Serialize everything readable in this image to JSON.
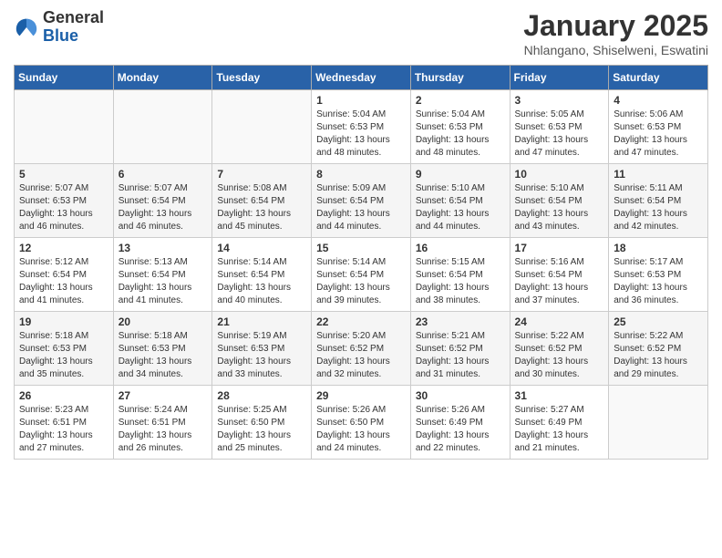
{
  "header": {
    "logo_general": "General",
    "logo_blue": "Blue",
    "title": "January 2025",
    "subtitle": "Nhlangano, Shiselweni, Eswatini"
  },
  "weekdays": [
    "Sunday",
    "Monday",
    "Tuesday",
    "Wednesday",
    "Thursday",
    "Friday",
    "Saturday"
  ],
  "weeks": [
    [
      {
        "num": "",
        "info": ""
      },
      {
        "num": "",
        "info": ""
      },
      {
        "num": "",
        "info": ""
      },
      {
        "num": "1",
        "info": "Sunrise: 5:04 AM\nSunset: 6:53 PM\nDaylight: 13 hours\nand 48 minutes."
      },
      {
        "num": "2",
        "info": "Sunrise: 5:04 AM\nSunset: 6:53 PM\nDaylight: 13 hours\nand 48 minutes."
      },
      {
        "num": "3",
        "info": "Sunrise: 5:05 AM\nSunset: 6:53 PM\nDaylight: 13 hours\nand 47 minutes."
      },
      {
        "num": "4",
        "info": "Sunrise: 5:06 AM\nSunset: 6:53 PM\nDaylight: 13 hours\nand 47 minutes."
      }
    ],
    [
      {
        "num": "5",
        "info": "Sunrise: 5:07 AM\nSunset: 6:53 PM\nDaylight: 13 hours\nand 46 minutes."
      },
      {
        "num": "6",
        "info": "Sunrise: 5:07 AM\nSunset: 6:54 PM\nDaylight: 13 hours\nand 46 minutes."
      },
      {
        "num": "7",
        "info": "Sunrise: 5:08 AM\nSunset: 6:54 PM\nDaylight: 13 hours\nand 45 minutes."
      },
      {
        "num": "8",
        "info": "Sunrise: 5:09 AM\nSunset: 6:54 PM\nDaylight: 13 hours\nand 44 minutes."
      },
      {
        "num": "9",
        "info": "Sunrise: 5:10 AM\nSunset: 6:54 PM\nDaylight: 13 hours\nand 44 minutes."
      },
      {
        "num": "10",
        "info": "Sunrise: 5:10 AM\nSunset: 6:54 PM\nDaylight: 13 hours\nand 43 minutes."
      },
      {
        "num": "11",
        "info": "Sunrise: 5:11 AM\nSunset: 6:54 PM\nDaylight: 13 hours\nand 42 minutes."
      }
    ],
    [
      {
        "num": "12",
        "info": "Sunrise: 5:12 AM\nSunset: 6:54 PM\nDaylight: 13 hours\nand 41 minutes."
      },
      {
        "num": "13",
        "info": "Sunrise: 5:13 AM\nSunset: 6:54 PM\nDaylight: 13 hours\nand 41 minutes."
      },
      {
        "num": "14",
        "info": "Sunrise: 5:14 AM\nSunset: 6:54 PM\nDaylight: 13 hours\nand 40 minutes."
      },
      {
        "num": "15",
        "info": "Sunrise: 5:14 AM\nSunset: 6:54 PM\nDaylight: 13 hours\nand 39 minutes."
      },
      {
        "num": "16",
        "info": "Sunrise: 5:15 AM\nSunset: 6:54 PM\nDaylight: 13 hours\nand 38 minutes."
      },
      {
        "num": "17",
        "info": "Sunrise: 5:16 AM\nSunset: 6:54 PM\nDaylight: 13 hours\nand 37 minutes."
      },
      {
        "num": "18",
        "info": "Sunrise: 5:17 AM\nSunset: 6:53 PM\nDaylight: 13 hours\nand 36 minutes."
      }
    ],
    [
      {
        "num": "19",
        "info": "Sunrise: 5:18 AM\nSunset: 6:53 PM\nDaylight: 13 hours\nand 35 minutes."
      },
      {
        "num": "20",
        "info": "Sunrise: 5:18 AM\nSunset: 6:53 PM\nDaylight: 13 hours\nand 34 minutes."
      },
      {
        "num": "21",
        "info": "Sunrise: 5:19 AM\nSunset: 6:53 PM\nDaylight: 13 hours\nand 33 minutes."
      },
      {
        "num": "22",
        "info": "Sunrise: 5:20 AM\nSunset: 6:52 PM\nDaylight: 13 hours\nand 32 minutes."
      },
      {
        "num": "23",
        "info": "Sunrise: 5:21 AM\nSunset: 6:52 PM\nDaylight: 13 hours\nand 31 minutes."
      },
      {
        "num": "24",
        "info": "Sunrise: 5:22 AM\nSunset: 6:52 PM\nDaylight: 13 hours\nand 30 minutes."
      },
      {
        "num": "25",
        "info": "Sunrise: 5:22 AM\nSunset: 6:52 PM\nDaylight: 13 hours\nand 29 minutes."
      }
    ],
    [
      {
        "num": "26",
        "info": "Sunrise: 5:23 AM\nSunset: 6:51 PM\nDaylight: 13 hours\nand 27 minutes."
      },
      {
        "num": "27",
        "info": "Sunrise: 5:24 AM\nSunset: 6:51 PM\nDaylight: 13 hours\nand 26 minutes."
      },
      {
        "num": "28",
        "info": "Sunrise: 5:25 AM\nSunset: 6:50 PM\nDaylight: 13 hours\nand 25 minutes."
      },
      {
        "num": "29",
        "info": "Sunrise: 5:26 AM\nSunset: 6:50 PM\nDaylight: 13 hours\nand 24 minutes."
      },
      {
        "num": "30",
        "info": "Sunrise: 5:26 AM\nSunset: 6:49 PM\nDaylight: 13 hours\nand 22 minutes."
      },
      {
        "num": "31",
        "info": "Sunrise: 5:27 AM\nSunset: 6:49 PM\nDaylight: 13 hours\nand 21 minutes."
      },
      {
        "num": "",
        "info": ""
      }
    ]
  ]
}
